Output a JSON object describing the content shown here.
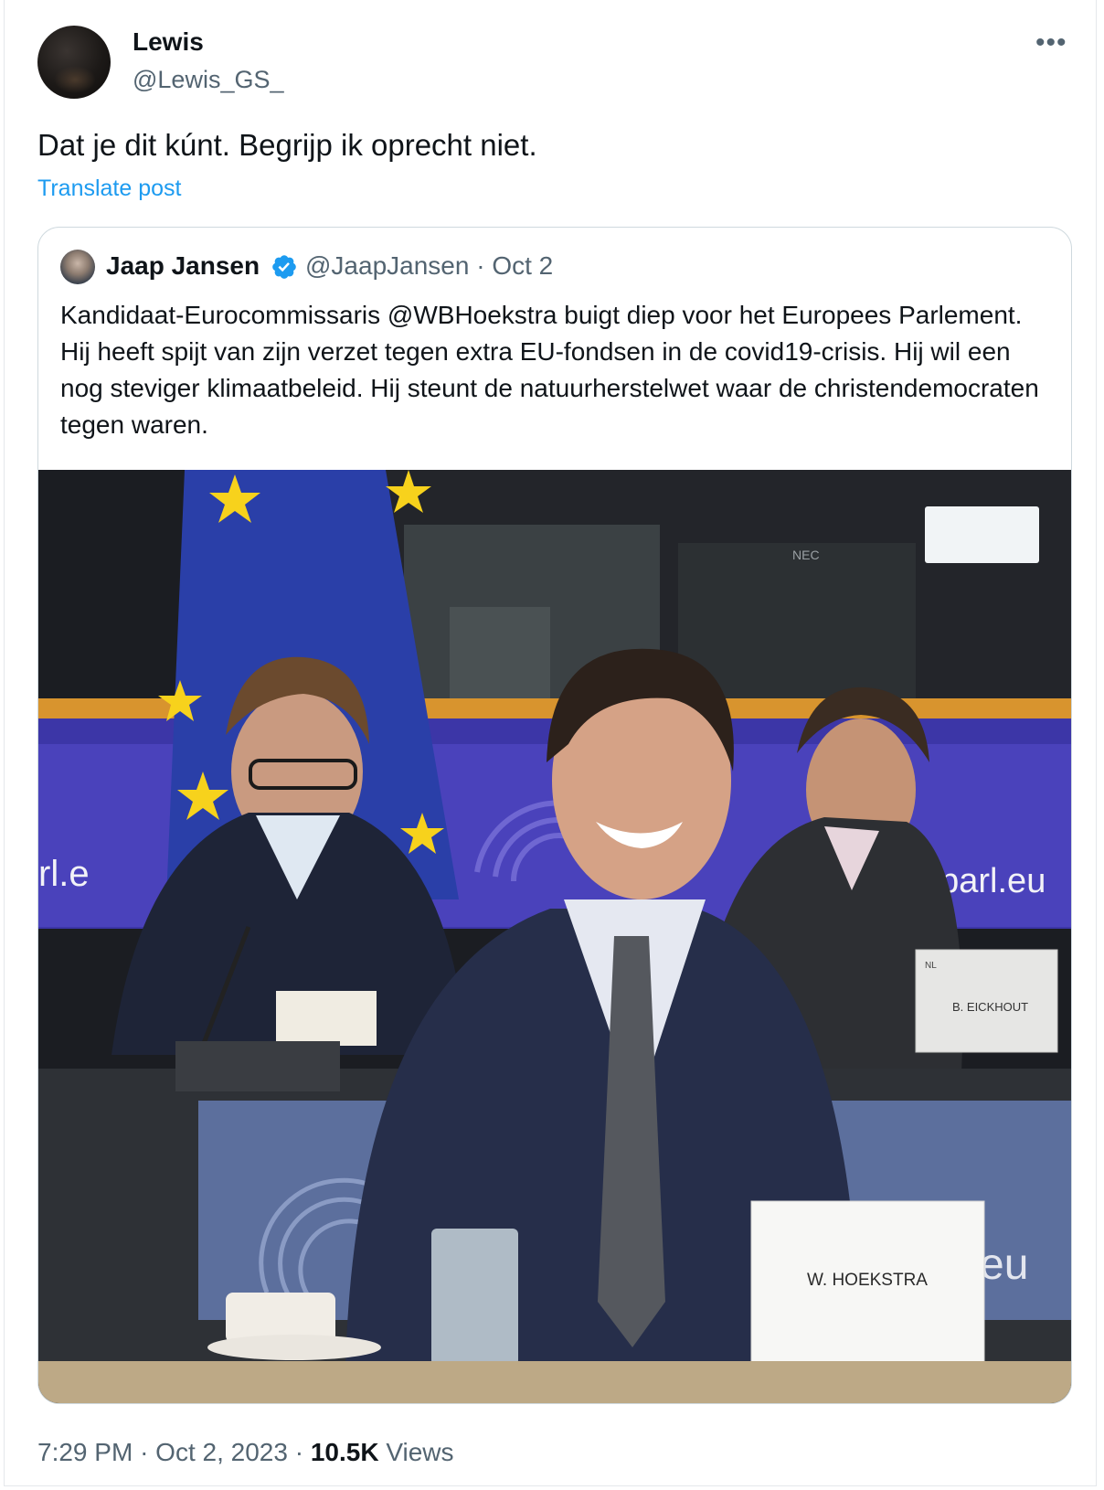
{
  "post": {
    "display_name": "Lewis",
    "handle": "@Lewis_GS_",
    "more_icon": "more-horizontal-icon",
    "text": "Dat je dit kúnt. Begrijp ik oprecht niet.",
    "translate_label": "Translate post",
    "time": "7:29 PM",
    "separator": "·",
    "date": "Oct 2, 2023",
    "views_count": "10.5K",
    "views_label": "Views"
  },
  "quote": {
    "display_name": "Jaap Jansen",
    "verified_icon": "verified-badge-icon",
    "handle": "@JaapJansen",
    "separator": "·",
    "date": "Oct 2",
    "text": "Kandidaat-Eurocommissaris @WBHoekstra buigt diep voor het Europees Parlement. Hij heeft spijt van zijn verzet tegen extra EU-fondsen in de covid19-crisis. Hij wil een nog steviger klimaatbeleid. Hij steunt de natuurherstelwet waar de christendemocraten tegen waren.",
    "photo": {
      "wall_text_left": "rl.e",
      "wall_text_right": "oparl.eu",
      "wall_text_bottom": "eu",
      "monitor_brand": "NEC",
      "nameplate_main": "W. HOEKSTRA",
      "nameplate_side": "B. EICKHOUT",
      "nameplate_side_code": "NL"
    }
  },
  "colors": {
    "accent": "#1d9bf0",
    "text_primary": "#0f1419",
    "text_secondary": "#536471",
    "border": "#cfd9de"
  }
}
